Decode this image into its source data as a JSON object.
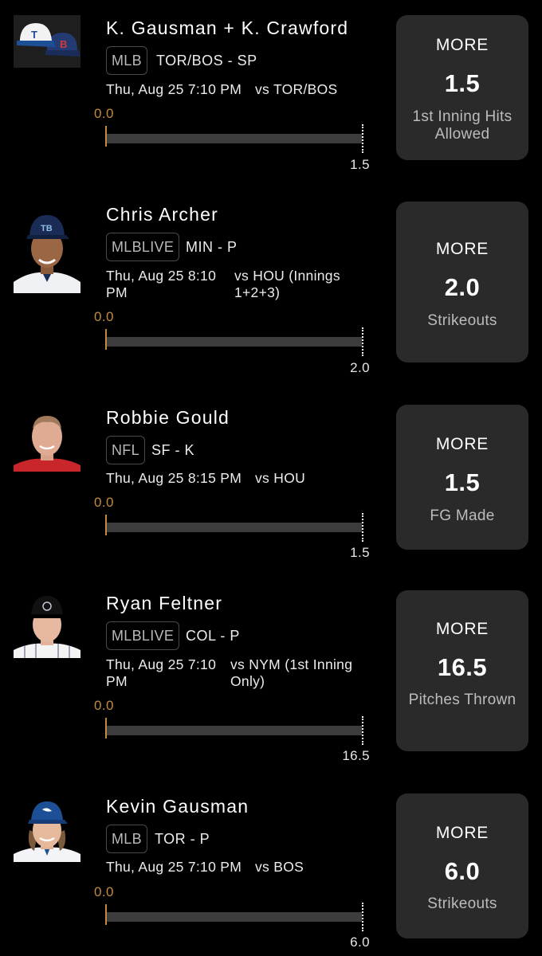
{
  "colors": {
    "accent": "#c48a3e",
    "card": "#2a2a2a",
    "background": "#000000"
  },
  "picks": [
    {
      "player": "K. Gausman + K. Crawford",
      "avatar": "tor-bos-caps-icon",
      "league": "MLB",
      "team_position": "TOR/BOS - SP",
      "game_time": "Thu, Aug 25 7:10 PM",
      "opponent": "vs TOR/BOS",
      "bar_min": "0.0",
      "bar_max": "1.5",
      "current_value": 0,
      "direction": "MORE",
      "line": "1.5",
      "stat": "1st Inning Hits Allowed"
    },
    {
      "player": "Chris Archer",
      "avatar": "rays-player-photo",
      "league": "MLBLIVE",
      "team_position": "MIN - P",
      "game_time": "Thu, Aug 25 8:10 PM",
      "opponent": "vs HOU (Innings 1+2+3)",
      "bar_min": "0.0",
      "bar_max": "2.0",
      "current_value": 0,
      "direction": "MORE",
      "line": "2.0",
      "stat": "Strikeouts"
    },
    {
      "player": "Robbie Gould",
      "avatar": "niners-player-photo",
      "league": "NFL",
      "team_position": "SF - K",
      "game_time": "Thu, Aug 25 8:15 PM",
      "opponent": "vs HOU",
      "bar_min": "0.0",
      "bar_max": "1.5",
      "current_value": 0,
      "direction": "MORE",
      "line": "1.5",
      "stat": "FG Made"
    },
    {
      "player": "Ryan Feltner",
      "avatar": "rockies-player-photo",
      "league": "MLBLIVE",
      "team_position": "COL - P",
      "game_time": "Thu, Aug 25 7:10 PM",
      "opponent": "vs NYM (1st Inning Only)",
      "bar_min": "0.0",
      "bar_max": "16.5",
      "current_value": 0,
      "direction": "MORE",
      "line": "16.5",
      "stat": "Pitches Thrown"
    },
    {
      "player": "Kevin Gausman",
      "avatar": "bluejays-player-photo",
      "league": "MLB",
      "team_position": "TOR - P",
      "game_time": "Thu, Aug 25 7:10 PM",
      "opponent": "vs BOS",
      "bar_min": "0.0",
      "bar_max": "6.0",
      "current_value": 0,
      "direction": "MORE",
      "line": "6.0",
      "stat": "Strikeouts"
    }
  ]
}
